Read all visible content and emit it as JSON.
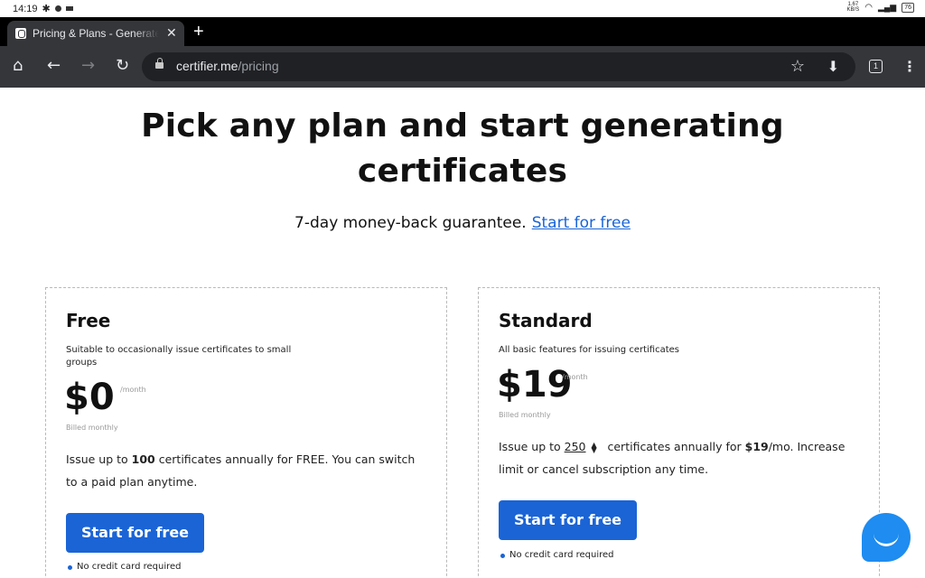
{
  "status_bar": {
    "time": "14:19",
    "net_speed": "1.67\nKB/S",
    "battery": "76",
    "left_icons": [
      "bluetooth-icon",
      "spotify-icon",
      "notification-icon"
    ],
    "right_icons": [
      "wifi-icon",
      "signal-icon",
      "battery-icon"
    ]
  },
  "browser": {
    "tab": {
      "title": "Pricing & Plans - Generate Di",
      "close": "✕",
      "favicon": "certifier-favicon"
    },
    "new_tab": "+",
    "nav": {
      "home": "⌂",
      "back": "←",
      "forward": "→",
      "reload": "↻"
    },
    "url": {
      "host": "certifier.me",
      "path": "/pricing"
    },
    "bookmark": "☆",
    "download": "⬇",
    "tab_count": "1",
    "menu": "⋮"
  },
  "page": {
    "headline_line1": "Pick any plan and start generating",
    "headline_line2": "certificates",
    "guarantee_text": "7-day money-back guarantee.",
    "guarantee_link": "Start for free",
    "plans": {
      "free": {
        "name": "Free",
        "description": "Suitable to occasionally issue certificates to small groups",
        "price": "$0",
        "period": "/month",
        "billing": "Billed monthly",
        "blurb_pre": "Issue up to ",
        "blurb_count": "100",
        "blurb_post": " certificates annually for FREE. You can switch to a paid plan anytime.",
        "cta": "Start for free",
        "note": "No credit card required"
      },
      "standard": {
        "name": "Standard",
        "description": "All basic features for issuing certificates",
        "price": "$19",
        "period": "/month",
        "billing": "Billed monthly",
        "blurb_pre": "Issue up to ",
        "blurb_count": "250",
        "blurb_mid": " certificates annually for ",
        "blurb_price": "$19",
        "blurb_post": "/mo. Increase limit or cancel subscription any time.",
        "cta": "Start for free",
        "note": "No credit card required"
      }
    },
    "chat_widget_icon": "chat-bubble-icon"
  }
}
